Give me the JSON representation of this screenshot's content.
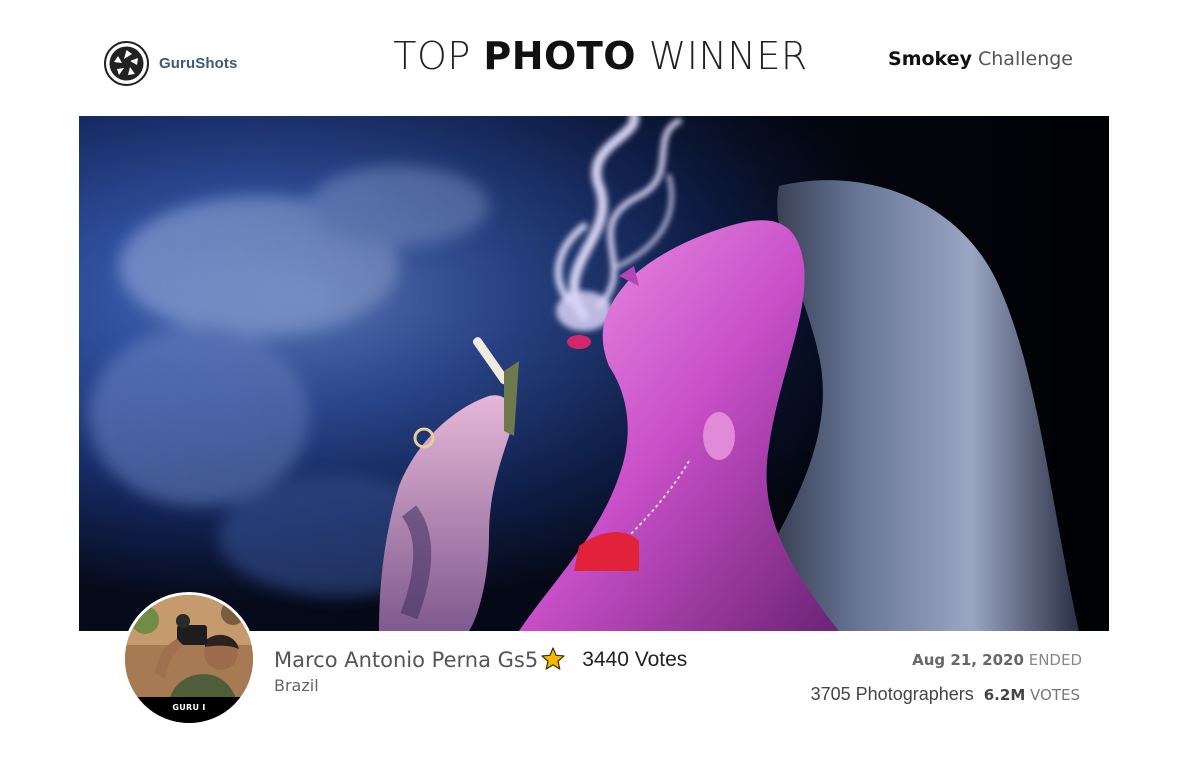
{
  "header": {
    "brand_name": "GuruShots",
    "title_part1": "TOP",
    "title_part2": "PHOTO",
    "title_part3": "WINNER",
    "challenge_name": "Smokey",
    "challenge_suffix": "Challenge"
  },
  "photo": {
    "icon": "winning-photo-image"
  },
  "photographer": {
    "name": "Marco Antonio Perna Gs5",
    "country": "Brazil",
    "votes_label": "3440 Votes",
    "rank_badge": "GURU I",
    "star_icon": "star-icon",
    "star_color": "#f5b800"
  },
  "challenge_stats": {
    "end_date": "Aug 21, 2020",
    "status": "ENDED",
    "photographers_label": "3705 Photographers",
    "total_votes": "6.2M",
    "total_votes_suffix": "VOTES"
  },
  "colors": {
    "brand_text": "#3b5b7d",
    "background": "#ffffff"
  }
}
